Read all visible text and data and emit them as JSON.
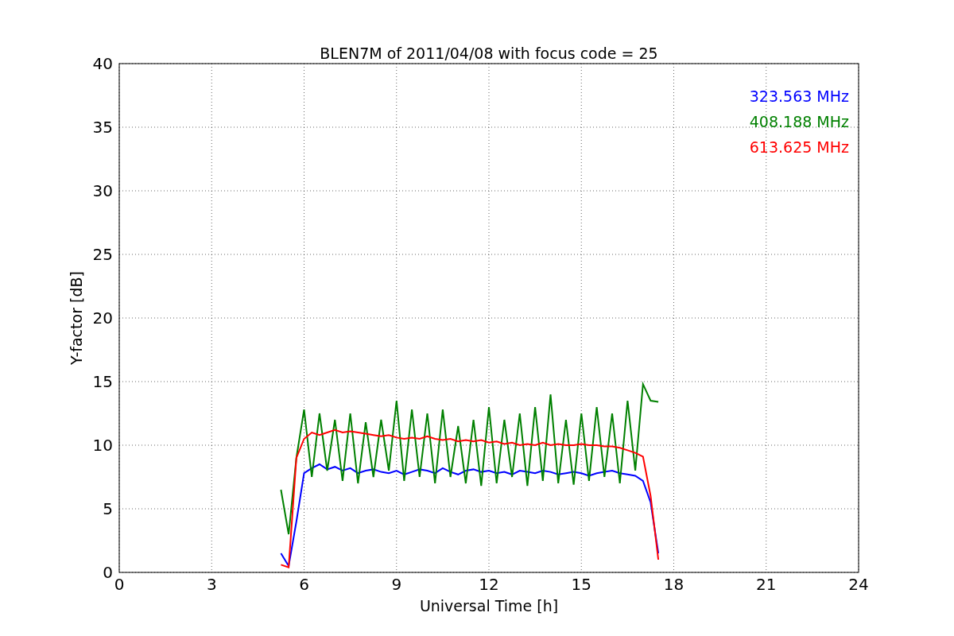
{
  "chart_data": {
    "type": "line",
    "title": "BLEN7M of 2011/04/08 with focus code = 25",
    "xlabel": "Universal Time [h]",
    "ylabel": "Y-factor [dB]",
    "x": [
      5.25,
      5.5,
      5.75,
      6,
      6.25,
      6.5,
      6.75,
      7,
      7.25,
      7.5,
      7.75,
      8,
      8.25,
      8.5,
      8.75,
      9,
      9.25,
      9.5,
      9.75,
      10,
      10.25,
      10.5,
      10.75,
      11,
      11.25,
      11.5,
      11.75,
      12,
      12.25,
      12.5,
      12.75,
      13,
      13.25,
      13.5,
      13.75,
      14,
      14.25,
      14.5,
      14.75,
      15,
      15.25,
      15.5,
      15.75,
      16,
      16.25,
      16.5,
      16.75,
      17,
      17.25,
      17.5
    ],
    "series": [
      {
        "name": "323.563 MHz",
        "color": "#0000ff",
        "values": [
          1.5,
          0.5,
          4,
          7.8,
          8.2,
          8.5,
          8.1,
          8.3,
          8,
          8.2,
          7.8,
          8,
          8.1,
          7.9,
          7.8,
          8,
          7.7,
          7.9,
          8.1,
          8,
          7.8,
          8.2,
          7.9,
          7.7,
          8,
          8.1,
          7.9,
          8,
          7.8,
          7.9,
          7.7,
          8,
          7.9,
          7.8,
          8,
          7.9,
          7.7,
          7.8,
          7.9,
          7.8,
          7.6,
          7.8,
          7.9,
          8,
          7.8,
          7.7,
          7.6,
          7.2,
          5.5,
          1.5
        ]
      },
      {
        "name": "408.188 MHz",
        "color": "#008000",
        "values": [
          6.5,
          3,
          9,
          12.8,
          7.5,
          12.5,
          8,
          12,
          7.2,
          12.5,
          7,
          11.8,
          7.5,
          12,
          8,
          13.5,
          7.2,
          12.8,
          7.5,
          12.5,
          7,
          12.8,
          7.5,
          11.5,
          7,
          12,
          6.8,
          13,
          7,
          12,
          7.5,
          12.5,
          6.8,
          13,
          7.2,
          14,
          7,
          12,
          6.9,
          12.5,
          7.2,
          13,
          7.5,
          12.5,
          7,
          13.5,
          8,
          14.8,
          13.5,
          13.4
        ]
      },
      {
        "name": "613.625 MHz",
        "color": "#ff0000",
        "values": [
          0.6,
          0.4,
          9,
          10.5,
          11,
          10.8,
          11,
          11.2,
          11,
          11.1,
          11,
          10.9,
          10.8,
          10.7,
          10.8,
          10.6,
          10.5,
          10.6,
          10.5,
          10.7,
          10.5,
          10.4,
          10.5,
          10.3,
          10.4,
          10.3,
          10.4,
          10.2,
          10.3,
          10.1,
          10.2,
          10,
          10.1,
          10,
          10.2,
          10,
          10.1,
          10,
          10,
          10.1,
          10,
          10,
          9.9,
          9.9,
          9.8,
          9.6,
          9.4,
          9.1,
          6,
          1
        ]
      }
    ],
    "grid": true,
    "xlim": [
      0,
      24
    ],
    "ylim": [
      0,
      40
    ],
    "xticks": [
      0,
      3,
      6,
      9,
      12,
      15,
      18,
      21,
      24
    ],
    "yticks": [
      0,
      5,
      10,
      15,
      20,
      25,
      30,
      35,
      40
    ]
  }
}
